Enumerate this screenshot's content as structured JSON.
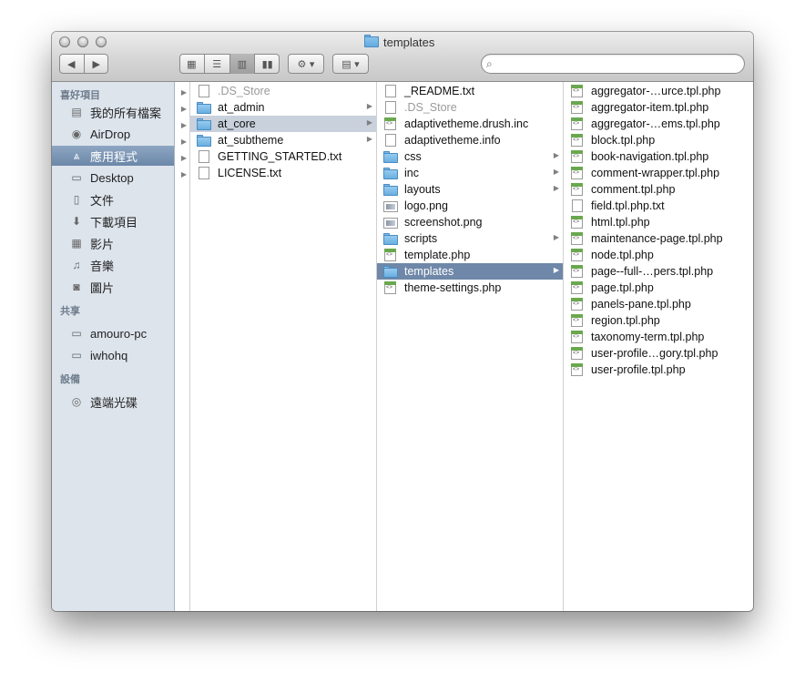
{
  "window": {
    "title": "templates"
  },
  "toolbar": {
    "back_icon": "◀",
    "forward_icon": "▶",
    "views": [
      "▦",
      "☰",
      "▥",
      "▮▮"
    ],
    "action_label": "⚙ ▾",
    "arrange_label": "▤ ▾",
    "search_placeholder": ""
  },
  "sidebar": {
    "sections": [
      {
        "heading": "喜好項目",
        "items": [
          {
            "label": "我的所有檔案",
            "icon": "all-files-icon",
            "glyph": "▤"
          },
          {
            "label": "AirDrop",
            "icon": "airdrop-icon",
            "glyph": "◉"
          },
          {
            "label": "應用程式",
            "icon": "applications-icon",
            "glyph": "⩓",
            "selected": true
          },
          {
            "label": "Desktop",
            "icon": "desktop-icon",
            "glyph": "▭"
          },
          {
            "label": "文件",
            "icon": "documents-icon",
            "glyph": "▯"
          },
          {
            "label": "下載項目",
            "icon": "downloads-icon",
            "glyph": "⬇"
          },
          {
            "label": "影片",
            "icon": "movies-icon",
            "glyph": "▦"
          },
          {
            "label": "音樂",
            "icon": "music-icon",
            "glyph": "♫"
          },
          {
            "label": "圖片",
            "icon": "pictures-icon",
            "glyph": "◙"
          }
        ]
      },
      {
        "heading": "共享",
        "items": [
          {
            "label": "amouro-pc",
            "icon": "computer-icon",
            "glyph": "▭"
          },
          {
            "label": "iwhohq",
            "icon": "computer-icon",
            "glyph": "▭"
          }
        ]
      },
      {
        "heading": "設備",
        "items": [
          {
            "label": "遠端光碟",
            "icon": "disc-icon",
            "glyph": "◎"
          }
        ]
      }
    ]
  },
  "columns": [
    {
      "items": []
    },
    {
      "items": [
        {
          "name": ".DS_Store",
          "type": "doc",
          "dim": true
        },
        {
          "name": "at_admin",
          "type": "folder",
          "arrow": true
        },
        {
          "name": "at_core",
          "type": "folder",
          "arrow": true,
          "selected": true
        },
        {
          "name": "at_subtheme",
          "type": "folder",
          "arrow": true
        },
        {
          "name": "GETTING_STARTED.txt",
          "type": "doc"
        },
        {
          "name": "LICENSE.txt",
          "type": "doc"
        }
      ]
    },
    {
      "items": [
        {
          "name": "_README.txt",
          "type": "doc"
        },
        {
          "name": ".DS_Store",
          "type": "doc",
          "dim": true
        },
        {
          "name": "adaptivetheme.drush.inc",
          "type": "php"
        },
        {
          "name": "adaptivetheme.info",
          "type": "doc"
        },
        {
          "name": "css",
          "type": "folder",
          "arrow": true
        },
        {
          "name": "inc",
          "type": "folder",
          "arrow": true
        },
        {
          "name": "layouts",
          "type": "folder",
          "arrow": true
        },
        {
          "name": "logo.png",
          "type": "img"
        },
        {
          "name": "screenshot.png",
          "type": "img"
        },
        {
          "name": "scripts",
          "type": "folder",
          "arrow": true
        },
        {
          "name": "template.php",
          "type": "php"
        },
        {
          "name": "templates",
          "type": "folder",
          "arrow": true,
          "active": true
        },
        {
          "name": "theme-settings.php",
          "type": "php"
        }
      ]
    },
    {
      "items": [
        {
          "name": "aggregator-…urce.tpl.php",
          "type": "php"
        },
        {
          "name": "aggregator-item.tpl.php",
          "type": "php"
        },
        {
          "name": "aggregator-…ems.tpl.php",
          "type": "php"
        },
        {
          "name": "block.tpl.php",
          "type": "php"
        },
        {
          "name": "book-navigation.tpl.php",
          "type": "php"
        },
        {
          "name": "comment-wrapper.tpl.php",
          "type": "php"
        },
        {
          "name": "comment.tpl.php",
          "type": "php"
        },
        {
          "name": "field.tpl.php.txt",
          "type": "doc"
        },
        {
          "name": "html.tpl.php",
          "type": "php"
        },
        {
          "name": "maintenance-page.tpl.php",
          "type": "php"
        },
        {
          "name": "node.tpl.php",
          "type": "php"
        },
        {
          "name": "page--full-…pers.tpl.php",
          "type": "php"
        },
        {
          "name": "page.tpl.php",
          "type": "php"
        },
        {
          "name": "panels-pane.tpl.php",
          "type": "php"
        },
        {
          "name": "region.tpl.php",
          "type": "php"
        },
        {
          "name": "taxonomy-term.tpl.php",
          "type": "php"
        },
        {
          "name": "user-profile…gory.tpl.php",
          "type": "php"
        },
        {
          "name": "user-profile.tpl.php",
          "type": "php"
        }
      ]
    }
  ]
}
